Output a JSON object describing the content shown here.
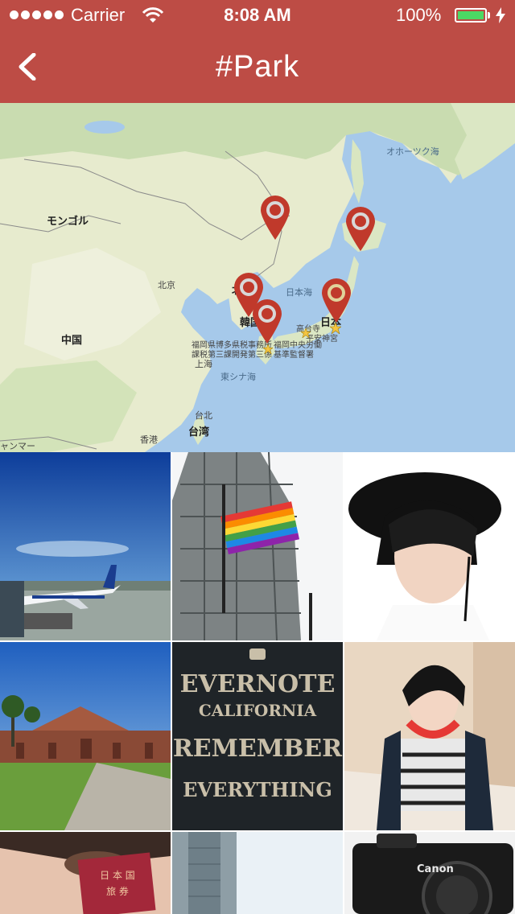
{
  "status_bar": {
    "carrier": "Carrier",
    "time": "8:08 AM",
    "battery": "100%",
    "battery_level": 1.0
  },
  "nav": {
    "title": "#Park",
    "back_icon": "chevron-left-icon"
  },
  "map": {
    "labels": {
      "mongolia": "モンゴル",
      "china": "中国",
      "beijing": "北京",
      "korea": "韓国",
      "korea_partial": "北朝",
      "japan_sea": "日本海",
      "japan": "日本",
      "okhotsk": "オホーツク海",
      "east_china_sea": "東シナ海",
      "shanghai": "上海",
      "taipei": "台北",
      "taiwan": "台湾",
      "hongkong": "香港",
      "myanmar": "ャンマー",
      "fukuoka1": "福岡県博多県税事務所",
      "fukuoka2": "課税第三課開発第三係",
      "fukuoka3": "福岡中央労働",
      "fukuoka4": "基準監督署",
      "takadai": "高台寺",
      "heian": "平安神宮"
    },
    "pins": [
      "map-pin",
      "map-pin",
      "map-pin",
      "map-pin",
      "map-pin"
    ]
  },
  "photos": [
    {
      "name": "photo-airplane"
    },
    {
      "name": "photo-rainbow-flag"
    },
    {
      "name": "photo-portrait-hat"
    },
    {
      "name": "photo-stanford"
    },
    {
      "name": "photo-evernote"
    },
    {
      "name": "photo-portrait-headphones"
    },
    {
      "name": "photo-passport"
    },
    {
      "name": "photo-building"
    },
    {
      "name": "photo-camera"
    }
  ],
  "evernote_art": {
    "line1": "EVERNOTE",
    "line2": "CALIFORNIA",
    "line3": "REMEMBER",
    "line4": "EVERYTHING"
  },
  "passport_art": {
    "line1": "日 本 国",
    "line2": "旅 券"
  },
  "camera_art": {
    "brand": "Canon"
  },
  "colors": {
    "header": "#bd4c45",
    "pin": "#c0392b",
    "battery": "#4cd964",
    "sea": "#a6c9ea",
    "land": "#e9ecd2"
  }
}
